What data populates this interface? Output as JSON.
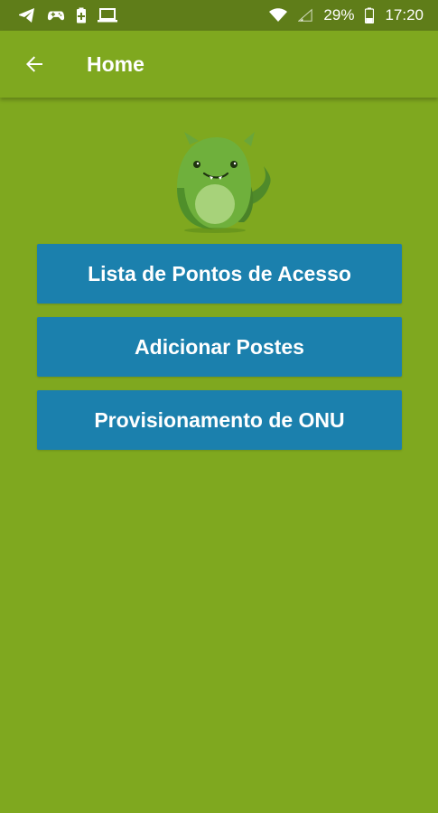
{
  "status_bar": {
    "icons_left": [
      "telegram-icon",
      "gamepad-icon",
      "battery-saver-icon",
      "laptop-icon"
    ],
    "icons_right": [
      "wifi-icon",
      "signal-icon",
      "battery-icon"
    ],
    "battery_percent": "29%",
    "time": "17:20"
  },
  "app_bar": {
    "back_icon": "arrow-back-icon",
    "title": "Home"
  },
  "menu": {
    "items": [
      {
        "label": "Lista de Pontos de Acesso"
      },
      {
        "label": "Adicionar Postes"
      },
      {
        "label": "Provisionamento de ONU"
      }
    ]
  },
  "colors": {
    "background": "#7fa81f",
    "status_bar": "#5f7d19",
    "button": "#1b80ad",
    "text": "#ffffff"
  }
}
